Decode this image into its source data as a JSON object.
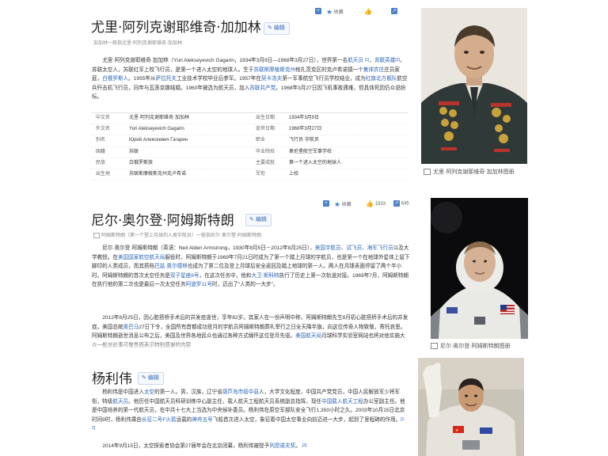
{
  "gagarin": {
    "title": "尤里·阿列克谢耶维奇·加加林",
    "edit_label": "编辑",
    "subtitle": "加加林一般指尤里·阿列克谢耶维奇·加加林",
    "toolbar": {
      "collect": "收藏"
    },
    "para": {
      "t1": "尤里·阿列克谢耶维奇·加加林（Yuri Alekseyevich Gagarin，1934年3月9日—1968年3月27日），世界第一名",
      "l1": "航天员",
      "r1": "[1]",
      "t2": "，",
      "l2": "苏联英雄",
      "r2": "[2]",
      "t3": "，苏联太空人，苏联红军上校飞行员，是第一个进入太空的地球人。生于",
      "l3": "苏联斯摩棱斯克州",
      "t4": "格扎茨克区的克卢希诺镇一个",
      "l4": "集体农庄",
      "t5": "庄员家庭，",
      "l5": "白俄罗斯人",
      "t6": "。1955年从",
      "l6": "萨拉托夫",
      "t7": "工业技术学校毕业后参军。1957年在",
      "l7": "契卡洛夫",
      "t8": "第一军事航空飞行员学校结业，成为",
      "l8": "红旗北方舰队",
      "t9": "航空兵歼击机飞行员，同年与瓦莲京娜结婚。1960年被选为航天员，加入",
      "l9": "苏联共产党",
      "t10": "。1968年3月27日因飞机事故遇难，但具体死因仍众说纷纭。"
    },
    "info": [
      {
        "k1": "中文名",
        "v1": "尤里·阿列克谢耶维奇·加加林",
        "k2": "出生日期",
        "v2": "1934年3月9日"
      },
      {
        "k1": "外文名",
        "v1": "Yuri Alekseyevich Gagarin",
        "k2": "逝世日期",
        "v2": "1968年3月27日"
      },
      {
        "k1": "别名",
        "v1": "Юрий Алексеевич Гагарин",
        "k2": "职业",
        "v2": "飞行员·宇航员"
      },
      {
        "k1": "国籍",
        "v1": "苏联",
        "k2": "毕业院校",
        "v2": "奥伦堡航空军事学校"
      },
      {
        "k1": "民族",
        "v1": "白俄罗斯族",
        "k2": "主要成就",
        "v2": "第一个进入太空的地球人"
      },
      {
        "k1": "出生地",
        "v1": "苏联斯摩棱斯克州克卢希诺",
        "k2": "军衔",
        "v2": "上校"
      }
    ],
    "caption": "尤里·阿列克谢耶维奇·加加林图册"
  },
  "armstrong": {
    "title": "尼尔·奥尔登·阿姆斯特朗",
    "edit_label": "编辑",
    "subtitle": "阿姆斯特朗（第一个登上月球的人类宇航员）一般指尼尔·奥尔登·阿姆斯特朗",
    "toolbar": {
      "collect": "收藏",
      "likes": "1933",
      "shares": "645"
    },
    "p1": {
      "t1": "尼尔·奥尔登·阿姆斯特朗（英语：Neil Alden Armstrong，1930年8月5日－2012年8月25日），",
      "l1": "美国宇航员",
      "t2": "、",
      "l2": "试飞员",
      "t3": "、",
      "l3": "海军飞行员",
      "t4": "以及大学教授。在",
      "l4": "美国国家航空航天局",
      "t5": "服役时，阿姆斯特朗于1969年7月21日时成为了第一个踏上月球的宇航员，也是第一个在地球外星体上留下脚印的人类成员，而其搭档",
      "l5": "巴兹·奥尔德林",
      "t6": "也成为了第二位及登上月球后安全返回及踏上地球的第一人。两人在月球表面停留了两个半小时。阿姆斯特朗的首次太空任务是",
      "l6": "双子星座8号",
      "t7": "，在这次任务中，他和",
      "l7": "大卫·斯科特",
      "t8": "执行了历史上第一次轨道对接。1969年7月，阿姆斯特朗在执行他的第二次也是最后一次太空任务",
      "l8": "阿波罗11号",
      "t9": "时，迈出了“人类的一大步”。"
    },
    "p2": {
      "t1": "2012年8月25日，因心脏搭桥手术后的并发症逝世，享年82岁。其家人在一份声明中称，阿姆斯特朗先生8月初心脏搭桥手术后的并发症。美国总统",
      "l1": "奥巴马",
      "t2": "27日下令，全国所有首都成功登月的宇航员阿姆斯特朗葬礼举行之日全天降半旗，向这位传奇人物致敬，寄托哀思。阿姆斯特朗逝世消息公布之后，美国及世界各地民众也通过各种方式缅怀这位登月先驱。",
      "l2": "美国航天局",
      "t3": "月球科学实验室网站也将对他实施大众一般对此事可敬畏而表示特别感谢的内容"
    },
    "caption": "尼尔·奥尔登·阿姆斯特朗图册"
  },
  "yang": {
    "title": "杨利伟",
    "edit_label": "编辑",
    "p1": {
      "t1": "杨利伟是中国进入",
      "l1": "太空",
      "t2": "的第一人。男，汉族，辽宁省",
      "l2": "葫芦岛市绥中县",
      "t3": "人，大学文化程度，中国共产党党员，中国人民解放军少将军衔，特级",
      "l3": "航天员",
      "t4": "。他历任中国航天员科研训练中心副主任，载人航天工程航天员系统副总指挥，现任",
      "l4": "中国载人航天工程",
      "t5": "办公室副主任。他是中国培养的第一代航天员，在中共十七大上当选为中央候补委员。杨利伟在原空军部队安全飞行1,350小时之久。2003年10月15日北京时间9时，杨利伟乘由",
      "l5": "长征二号F火箭",
      "t6": "运载的",
      "l6": "神舟五号",
      "t7": "飞船首次进入太空，象征着中国太空事业向前迈进一大步，起到了里程碑的作用。",
      "r1": "[1-2]"
    },
    "p2": {
      "t1": "2014年9月15日，太空探索者协会第27届年会在北京闭幕，杨利伟被授予",
      "l1": "列昂诺夫奖",
      "t2": "。",
      "r1": "[3]"
    }
  },
  "colors": {
    "link": "#2a64b3",
    "accent": "#4a82c8",
    "title": "#222222"
  }
}
